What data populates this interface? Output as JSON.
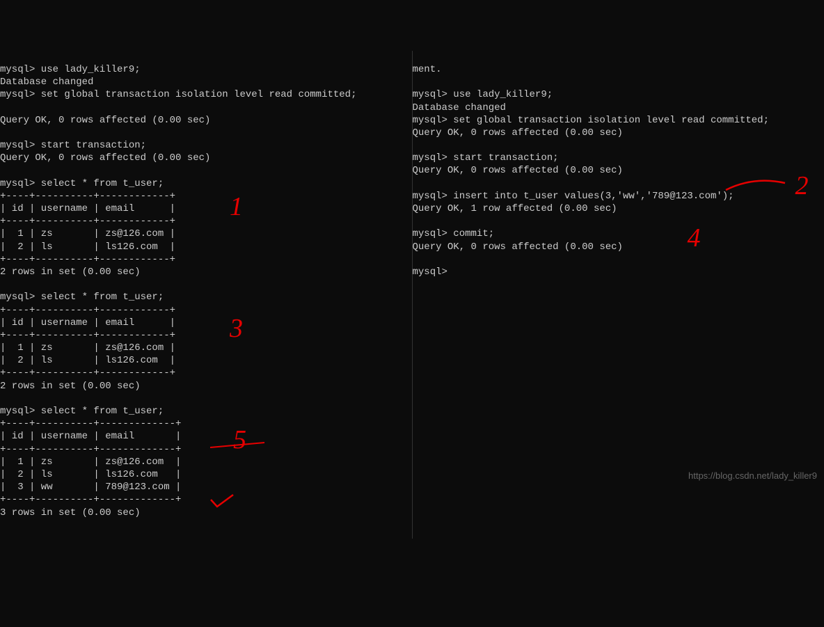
{
  "left": {
    "l1": "mysql> use lady_killer9;",
    "l2": "Database changed",
    "l3": "mysql> set global transaction isolation level read committed;",
    "l4": "",
    "l5": "Query OK, 0 rows affected (0.00 sec)",
    "l6": "",
    "l7": "mysql> start transaction;",
    "l8": "Query OK, 0 rows affected (0.00 sec)",
    "l9": "",
    "l10": "mysql> select * from t_user;",
    "t1_border_top": "+----+----------+------------+",
    "t1_header": "| id | username | email      |",
    "t1_border_mid": "+----+----------+------------+",
    "t1_row1": "|  1 | zs       | zs@126.com |",
    "t1_row2": "|  2 | ls       | ls126.com  |",
    "t1_border_bot": "+----+----------+------------+",
    "t1_footer": "2 rows in set (0.00 sec)",
    "l11": "",
    "l12": "mysql> select * from t_user;",
    "t2_border_top": "+----+----------+------------+",
    "t2_header": "| id | username | email      |",
    "t2_border_mid": "+----+----------+------------+",
    "t2_row1": "|  1 | zs       | zs@126.com |",
    "t2_row2": "|  2 | ls       | ls126.com  |",
    "t2_border_bot": "+----+----------+------------+",
    "t2_footer": "2 rows in set (0.00 sec)",
    "l13": "",
    "l14": "mysql> select * from t_user;",
    "t3_border_top": "+----+----------+-------------+",
    "t3_header": "| id | username | email       |",
    "t3_border_mid": "+----+----------+-------------+",
    "t3_row1": "|  1 | zs       | zs@126.com  |",
    "t3_row2": "|  2 | ls       | ls126.com   |",
    "t3_row3": "|  3 | ww       | 789@123.com |",
    "t3_border_bot": "+----+----------+-------------+",
    "t3_footer": "3 rows in set (0.00 sec)"
  },
  "right": {
    "r0": "ment.",
    "r1": "",
    "r2": "mysql> use lady_killer9;",
    "r3": "Database changed",
    "r4": "mysql> set global transaction isolation level read committed;",
    "r5": "Query OK, 0 rows affected (0.00 sec)",
    "r6": "",
    "r7": "mysql> start transaction;",
    "r8": "Query OK, 0 rows affected (0.00 sec)",
    "r9": "",
    "r10": "mysql> insert into t_user values(3,'ww','789@123.com');",
    "r11": "Query OK, 1 row affected (0.00 sec)",
    "r12": "",
    "r13": "mysql> commit;",
    "r14": "Query OK, 0 rows affected (0.00 sec)",
    "r15": "",
    "r16": "mysql>"
  },
  "annotations": {
    "a1": "1",
    "a2": "2",
    "a3": "3",
    "a4": "4",
    "a5": "5"
  },
  "watermark": "https://blog.csdn.net/lady_killer9"
}
